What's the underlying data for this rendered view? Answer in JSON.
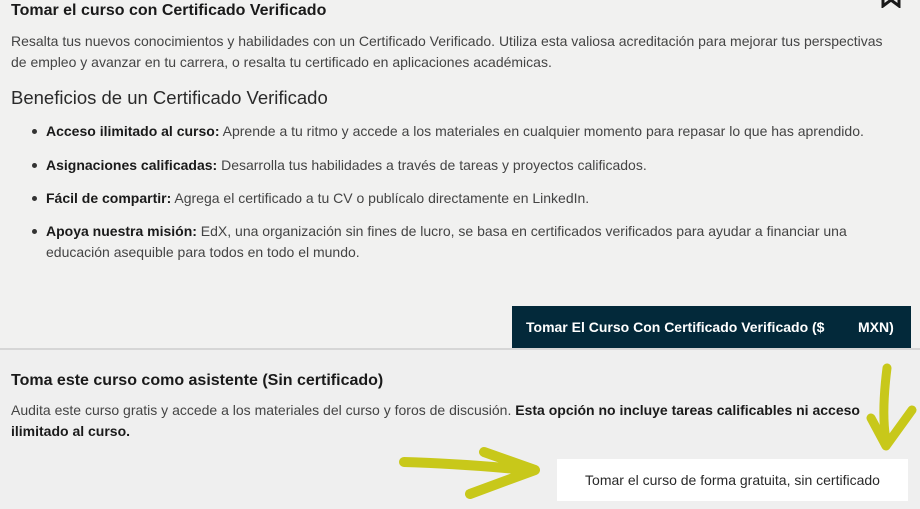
{
  "verified": {
    "title": "Tomar el curso con Certificado Verificado",
    "description": "Resalta tus nuevos conocimientos y habilidades con un Certificado Verificado. Utiliza esta valiosa acreditación para mejorar tus perspectivas de empleo y avanzar en tu carrera, o resalta tu certificado en aplicaciones académicas.",
    "benefits_title": "Beneficios de un Certificado Verificado",
    "benefits": [
      {
        "label": "Acceso ilimitado al curso:",
        "text": " Aprende a tu ritmo y accede a los materiales en cualquier momento para repasar lo que has aprendido."
      },
      {
        "label": "Asignaciones calificadas:",
        "text": " Desarrolla tus habilidades a través de tareas y proyectos calificados."
      },
      {
        "label": "Fácil de compartir:",
        "text": " Agrega el certificado a tu CV o publícalo directamente en LinkedIn."
      },
      {
        "label": "Apoya nuestra misión:",
        "text": " EdX, una organización sin fines de lucro, se basa en certificados verificados para ayudar a financiar una educación asequible para todos en todo el mundo."
      }
    ],
    "button_label": "Tomar El Curso Con Certificado Verificado ($",
    "button_currency": "MXN)"
  },
  "audit": {
    "title": "Toma este curso como asistente (Sin certificado)",
    "description": "Audita este curso gratis y accede a los materiales del curso y foros de discusión. ",
    "description_bold": "Esta opción no incluye tareas calificables ni acceso ilimitado al curso.",
    "button_label": "Tomar el curso de forma gratuita, sin certificado"
  },
  "colors": {
    "button_dark": "#03293a",
    "annotation_arrow": "#c8c81a"
  },
  "icons": [
    "bookmark-icon"
  ]
}
